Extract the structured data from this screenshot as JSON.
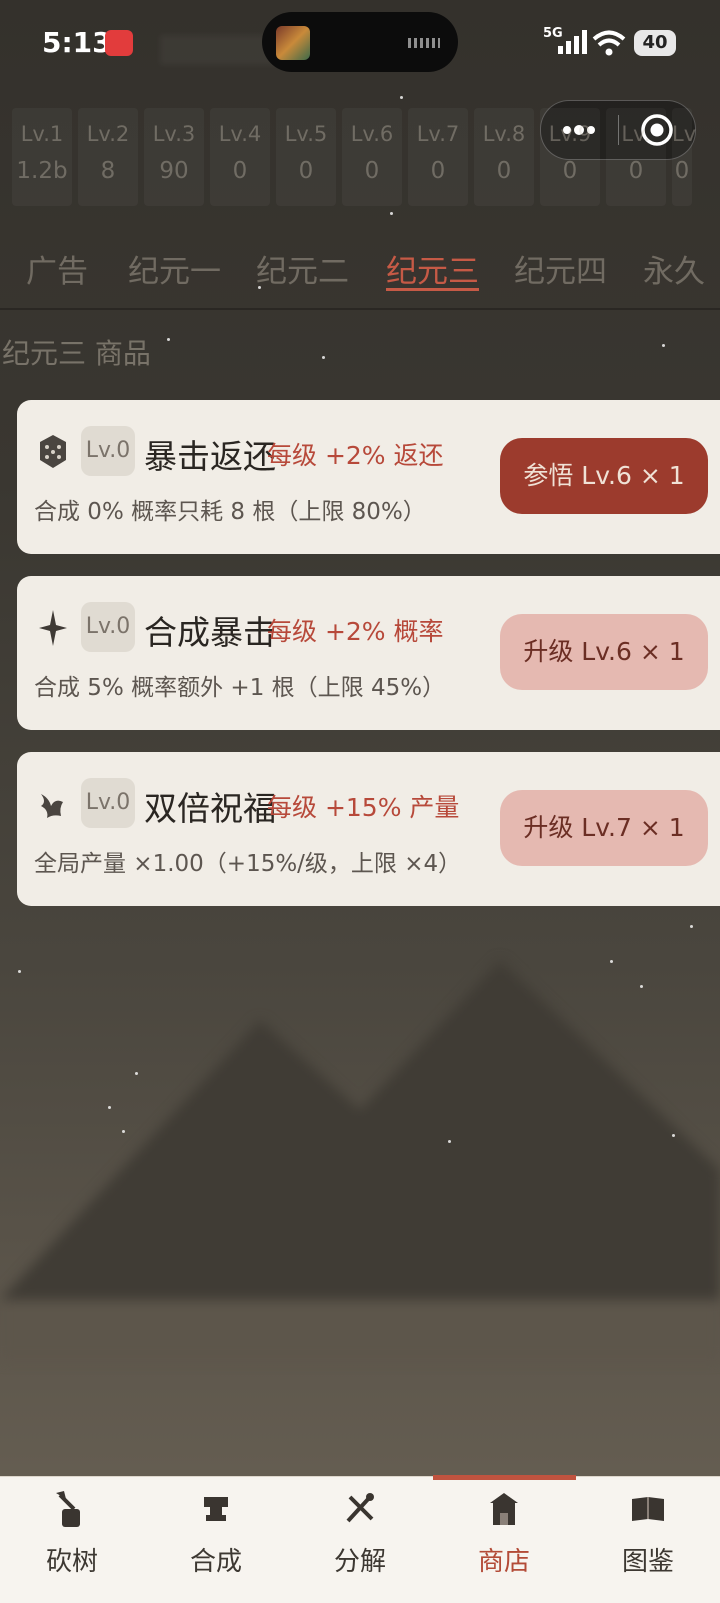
{
  "status_bar": {
    "time": "5:13",
    "network": "5G",
    "battery": "40"
  },
  "levels": [
    {
      "label": "Lv.1",
      "value": "1.2b"
    },
    {
      "label": "Lv.2",
      "value": "8"
    },
    {
      "label": "Lv.3",
      "value": "90"
    },
    {
      "label": "Lv.4",
      "value": "0"
    },
    {
      "label": "Lv.5",
      "value": "0"
    },
    {
      "label": "Lv.6",
      "value": "0"
    },
    {
      "label": "Lv.7",
      "value": "0"
    },
    {
      "label": "Lv.8",
      "value": "0"
    },
    {
      "label": "Lv.9",
      "value": "0"
    },
    {
      "label": "Lv.",
      "value": "0"
    },
    {
      "label": "Lv",
      "value": "0"
    }
  ],
  "tabs": [
    {
      "label": "广告"
    },
    {
      "label": "纪元一"
    },
    {
      "label": "纪元二"
    },
    {
      "label": "纪元三"
    },
    {
      "label": "纪元四"
    },
    {
      "label": "永久"
    }
  ],
  "active_tab": "纪元三",
  "section_title": "纪元三 商品",
  "items": [
    {
      "icon": "dice-icon",
      "level": "Lv.0",
      "name": "暴击返还",
      "bonus": "每级 +2% 返还",
      "desc": "合成 0% 概率只耗 8 根（上限 80%）",
      "button": "参悟 Lv.6 × 1"
    },
    {
      "icon": "star-icon",
      "level": "Lv.0",
      "name": "合成暴击",
      "bonus": "每级 +2% 概率",
      "desc": "合成 5% 概率额外 +1 根（上限 45%）",
      "button": "升级 Lv.6 × 1"
    },
    {
      "icon": "bird-icon",
      "level": "Lv.0",
      "name": "双倍祝福",
      "bonus": "每级 +15% 产量",
      "desc": "全局产量 ×1.00（+15%/级，上限 ×4）",
      "button": "升级 Lv.7 × 1"
    }
  ],
  "bottom_nav": [
    {
      "label": "砍树",
      "icon": "axe-stump-icon"
    },
    {
      "label": "合成",
      "icon": "anvil-icon"
    },
    {
      "label": "分解",
      "icon": "tools-icon"
    },
    {
      "label": "商店",
      "icon": "shop-icon"
    },
    {
      "label": "图鉴",
      "icon": "book-icon"
    }
  ],
  "active_nav": "商店",
  "colors": {
    "accent": "#c0533f",
    "primary_button": "#9c3b2d",
    "secondary_button": "#e5b9b1",
    "card": "#f1ede6"
  }
}
